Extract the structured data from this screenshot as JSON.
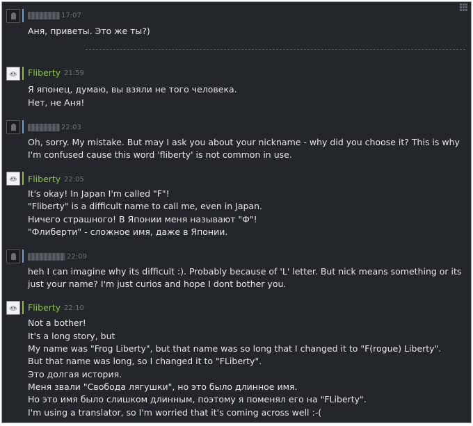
{
  "messages": [
    {
      "name": "",
      "time": "17:07",
      "name_censored": true,
      "lines": [
        "Аня, приветы. Это же ты?)"
      ]
    },
    {
      "name": "Fliberty",
      "time": "21:59",
      "lines": [
        "Я японец, думаю, вы взяли не того человека.",
        "Нет, не Аня!"
      ]
    },
    {
      "name": "",
      "time": "22:03",
      "name_censored": true,
      "lines": [
        "Oh, sorry. My mistake. But may I ask you about your nickname - why did you choose it? This is why",
        "I'm confused cause this word 'fliberty' is not common in use."
      ]
    },
    {
      "name": "Fliberty",
      "time": "22:05",
      "lines": [
        "It's okay! In Japan I'm called \"F\"!",
        "\"Fliberty\" is a difficult name to call me, even in Japan.",
        "Ничего страшного! В Японии меня называют \"Ф\"!",
        "\"Флиберти\" - сложное имя, даже в Японии."
      ]
    },
    {
      "name": "",
      "time": "22:09",
      "name_censored": true,
      "lines": [
        "heh I can imagine why its difficult :). Probably because of 'L' letter. But nick means something or its",
        "just your name? I'm just curios and hope I dont bother you."
      ]
    },
    {
      "name": "Fliberty",
      "time": "22:10",
      "lines": [
        "Not a bother!",
        "It's a long story, but",
        "My name was \"Frog Liberty\", but that name was so long that I changed it to \"F(rogue) Liberty\".",
        "But that name was long, so I changed it to \"FLiberty\".",
        "Это долгая история.",
        "Меня звали \"Свобода лягушки\", но это было длинное имя.",
        "Но это имя было слишком длинным, поэтому я поменял его на \"FLiberty\".",
        "I'm using a translator, so I'm worried that it's coming across well :-("
      ]
    }
  ]
}
